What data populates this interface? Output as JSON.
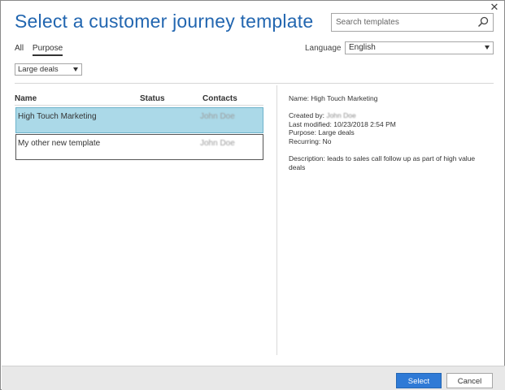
{
  "dialog": {
    "title": "Select a customer journey template",
    "close_symbol": "✕"
  },
  "search": {
    "placeholder": "Search templates",
    "icon": "search-icon"
  },
  "tabs": [
    {
      "label": "All",
      "active": false
    },
    {
      "label": "Purpose",
      "active": true
    }
  ],
  "language": {
    "label": "Language",
    "value": "English"
  },
  "purpose_filter": {
    "value": "Large deals"
  },
  "table": {
    "columns": [
      "Name",
      "Status",
      "Contacts"
    ],
    "rows": [
      {
        "name": "High Touch Marketing",
        "status": "",
        "contact": "John Doe",
        "selected": true
      },
      {
        "name": "My other new template",
        "status": "",
        "contact": "John Doe",
        "selected": false
      }
    ]
  },
  "details": {
    "name_line": "Name: High Touch Marketing",
    "created_by_label": "Created by: ",
    "created_by_value": "John Doe",
    "last_modified": "Last modified: 10/23/2018 2:54 PM",
    "purpose": "Purpose: Large deals",
    "recurring": "Recurring: No",
    "description": "Description: leads to sales call follow up as part of high value deals"
  },
  "footer": {
    "select_label": "Select",
    "cancel_label": "Cancel"
  },
  "colors": {
    "title": "#2266b0",
    "selected_row": "#abd9e8",
    "primary_button": "#2f7ad6"
  }
}
